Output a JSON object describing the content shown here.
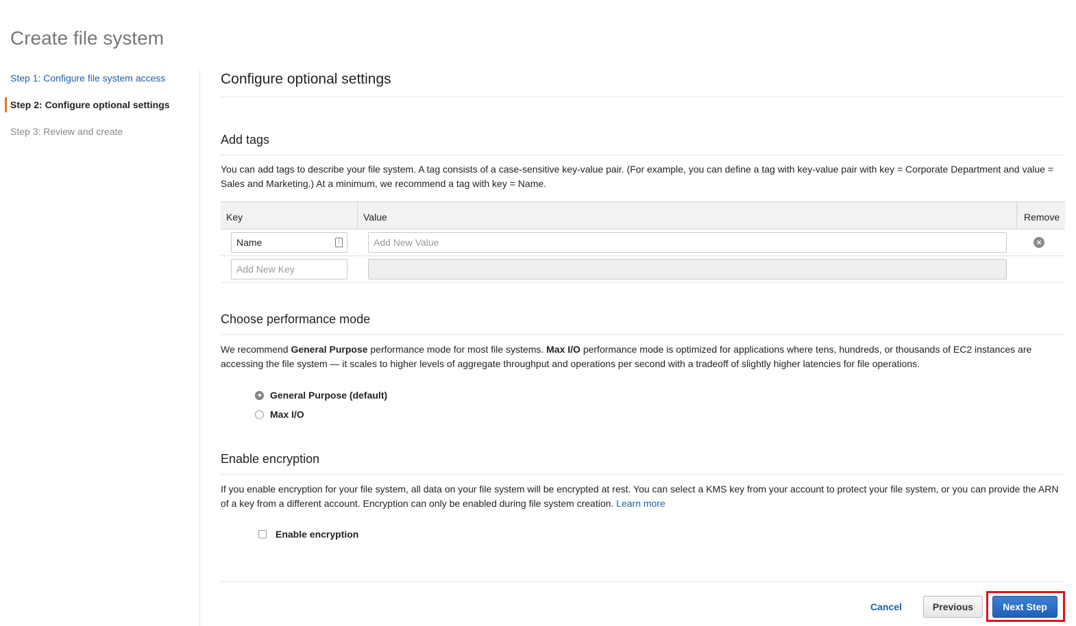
{
  "page": {
    "title": "Create file system"
  },
  "wizard": {
    "steps": [
      {
        "label": "Step 1: Configure file system access"
      },
      {
        "label": "Step 2: Configure optional settings"
      },
      {
        "label": "Step 3: Review and create"
      }
    ]
  },
  "main": {
    "title": "Configure optional settings",
    "tags": {
      "title": "Add tags",
      "description": "You can add tags to describe your file system. A tag consists of a case-sensitive key-value pair. (For example, you can define a tag with key-value pair with key = Corporate Department and value = Sales and Marketing.) At a minimum, we recommend a tag with key = Name.",
      "columns": {
        "key": "Key",
        "value": "Value",
        "remove": "Remove"
      },
      "rows": [
        {
          "key": "Name",
          "value_placeholder": "Add New Value"
        },
        {
          "key_placeholder": "Add New Key"
        }
      ]
    },
    "performance": {
      "title": "Choose performance mode",
      "desc_part1": "We recommend ",
      "desc_bold1": "General Purpose",
      "desc_part2": " performance mode for most file systems. ",
      "desc_bold2": "Max I/O",
      "desc_part3": " performance mode is optimized for applications where tens, hundreds, or thousands of EC2 instances are accessing the file system — it scales to higher levels of aggregate throughput and operations per second with a tradeoff of slightly higher latencies for file operations.",
      "options": [
        {
          "label": "General Purpose (default)",
          "selected": true
        },
        {
          "label": "Max I/O",
          "selected": false
        }
      ]
    },
    "encryption": {
      "title": "Enable encryption",
      "description": "If you enable encryption for your file system, all data on your file system will be encrypted at rest. You can select a KMS key from your account to protect your file system, or you can provide the ARN of a key from a different account. Encryption can only be enabled during file system creation. ",
      "learn_more": "Learn more",
      "checkbox_label": "Enable encryption",
      "checked": false
    }
  },
  "footer": {
    "cancel": "Cancel",
    "previous": "Previous",
    "next": "Next Step"
  },
  "colors": {
    "link": "#1f5fa9",
    "active_step_marker": "#e47911",
    "primary_button": "#1f5fb8",
    "highlight_outline": "#e0121b"
  }
}
